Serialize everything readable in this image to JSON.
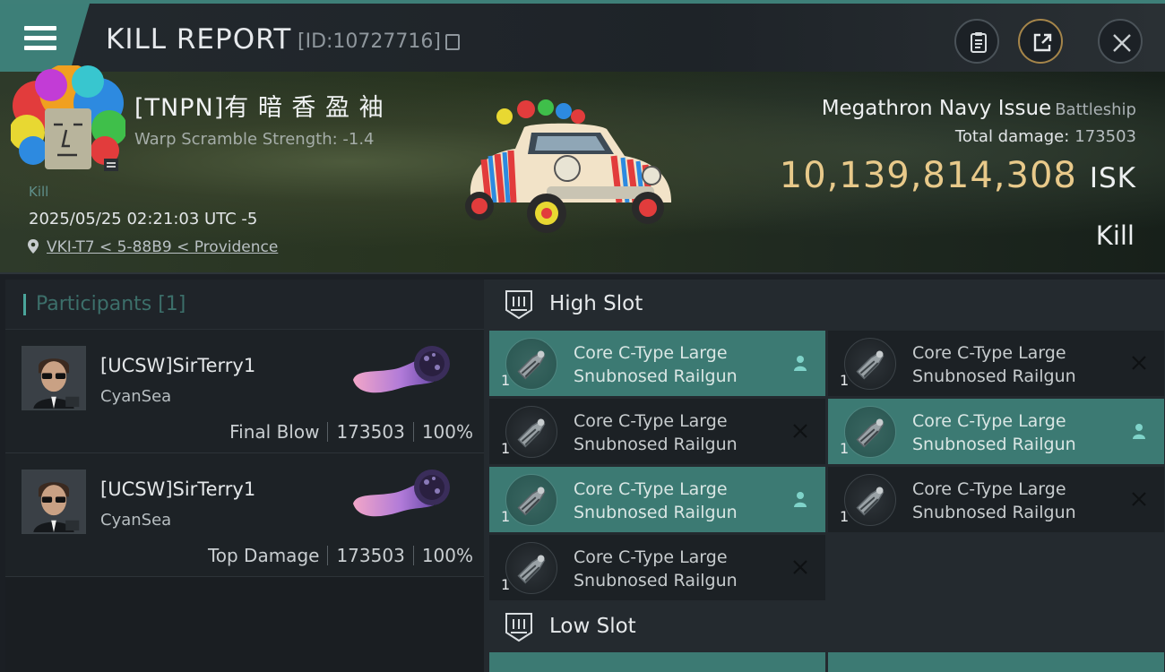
{
  "header": {
    "title": "KILL REPORT",
    "report_id": "[ID:10727716]"
  },
  "victim": {
    "name": "[TNPN]有 暗 香 盈 袖",
    "warp_scramble": "Warp Scramble Strength: -1.4",
    "kill_tag": "Kill",
    "datetime": "2025/05/25 02:21:03 UTC -5",
    "location": "VKI-T7 < 5-88B9 < Providence"
  },
  "ship": {
    "name": "Megathron Navy Issue",
    "class": "Battleship",
    "total_damage_label": "Total damage:",
    "total_damage": "173503",
    "value": "10,139,814,308",
    "value_unit": "ISK",
    "outcome": "Kill"
  },
  "participants": {
    "label": "Participants [1]",
    "rows": [
      {
        "name": "[UCSW]SirTerry1",
        "corp": "CyanSea",
        "role": "Final Blow",
        "damage": "173503",
        "percent": "100%"
      },
      {
        "name": "[UCSW]SirTerry1",
        "corp": "CyanSea",
        "role": "Top Damage",
        "damage": "173503",
        "percent": "100%"
      }
    ]
  },
  "slots": {
    "high_label": "High Slot",
    "low_label": "Low Slot",
    "high_modules": [
      {
        "line1": "Core C-Type Large",
        "line2": "Snubnosed Railgun",
        "qty": "1",
        "status": "dropped"
      },
      {
        "line1": "Core C-Type Large",
        "line2": "Snubnosed Railgun",
        "qty": "1",
        "status": "destroyed"
      },
      {
        "line1": "Core C-Type Large",
        "line2": "Snubnosed Railgun",
        "qty": "1",
        "status": "destroyed"
      },
      {
        "line1": "Core C-Type Large",
        "line2": "Snubnosed Railgun",
        "qty": "1",
        "status": "dropped"
      },
      {
        "line1": "Core C-Type Large",
        "line2": "Snubnosed Railgun",
        "qty": "1",
        "status": "dropped"
      },
      {
        "line1": "Core C-Type Large",
        "line2": "Snubnosed Railgun",
        "qty": "1",
        "status": "destroyed"
      },
      {
        "line1": "Core C-Type Large",
        "line2": "Snubnosed Railgun",
        "qty": "1",
        "status": "destroyed"
      }
    ]
  },
  "colors": {
    "accent": "#3c7a73",
    "isk_gold": "#e8c98a"
  }
}
